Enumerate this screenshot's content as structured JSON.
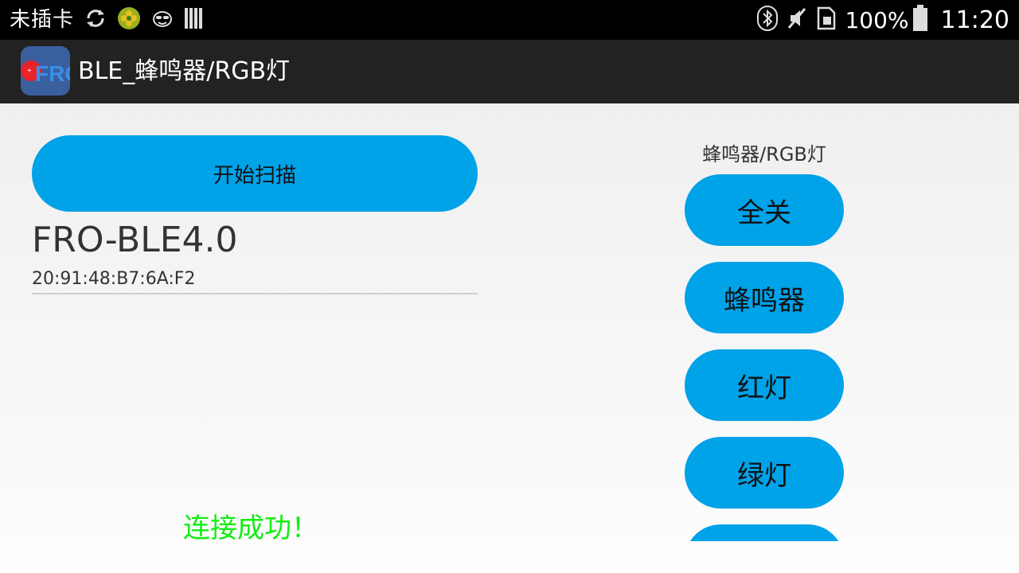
{
  "status_bar": {
    "carrier": "未插卡",
    "left_icons": [
      "sync-icon",
      "clover-app-icon",
      "face-icon",
      "bars-icon"
    ],
    "right_icons": [
      "bluetooth-icon",
      "mute-icon",
      "sim-icon"
    ],
    "battery_percent": "100%",
    "clock": "11:20"
  },
  "app": {
    "title": "BLE_蜂鸣器/RGB灯",
    "logo_text": "FRO"
  },
  "scan": {
    "label": "开始扫描"
  },
  "device": {
    "name": "FRO-BLE4.0",
    "address": "20:91:48:B7:6A:F2"
  },
  "connection_status": "连接成功！",
  "controls": {
    "title": "蜂鸣器/RGB灯",
    "buttons": [
      "全关",
      "蜂鸣器",
      "红灯",
      "绿灯"
    ]
  },
  "colors": {
    "button": "#00a2e8",
    "success_text": "#11ee11",
    "action_bar": "#222222"
  }
}
